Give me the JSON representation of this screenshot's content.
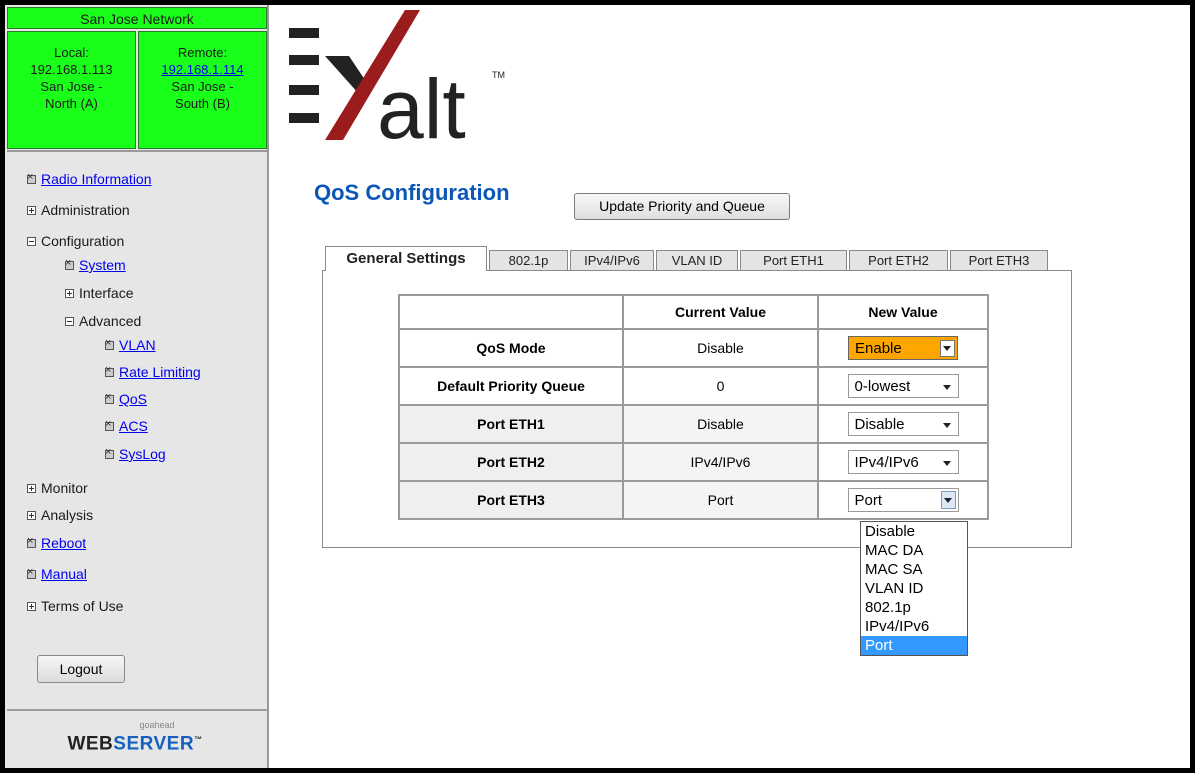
{
  "sidebar": {
    "network_title": "San Jose Network",
    "local": {
      "label": "Local:",
      "ip": "192.168.1.113",
      "site_line1": "San Jose -",
      "site_line2": "North (A)"
    },
    "remote": {
      "label": "Remote:",
      "ip": "192.168.1.114",
      "site_line1": "San Jose -",
      "site_line2": "South (B)"
    },
    "nav": {
      "radio_information": "Radio Information",
      "administration": "Administration",
      "configuration": "Configuration",
      "system": "System",
      "interface": "Interface",
      "advanced": "Advanced",
      "vlan": "VLAN",
      "rate_limiting": "Rate Limiting",
      "qos": "QoS",
      "acs": "ACS",
      "syslog": "SysLog",
      "monitor": "Monitor",
      "analysis": "Analysis",
      "reboot": "Reboot",
      "manual": "Manual",
      "terms_of_use": "Terms of Use"
    },
    "logout_label": "Logout",
    "footer": {
      "small": "goahead",
      "web": "WEB",
      "server": "SERVER",
      "tm": "™"
    }
  },
  "logo": {
    "text": "alt",
    "tm": "TM"
  },
  "main": {
    "title": "QoS Configuration",
    "update_button": "Update Priority and Queue",
    "tabs": [
      "General Settings",
      "802.1p",
      "IPv4/IPv6",
      "VLAN ID",
      "Port ETH1",
      "Port ETH2",
      "Port ETH3"
    ],
    "table": {
      "header": {
        "current": "Current Value",
        "new": "New Value"
      },
      "rows": [
        {
          "label": "QoS Mode",
          "current": "Disable",
          "new": "Enable"
        },
        {
          "label": "Default Priority Queue",
          "current": "0",
          "new": "0-lowest"
        },
        {
          "label": "Port ETH1",
          "current": "Disable",
          "new": "Disable"
        },
        {
          "label": "Port ETH2",
          "current": "IPv4/IPv6",
          "new": "IPv4/IPv6"
        },
        {
          "label": "Port ETH3",
          "current": "Port",
          "new": "Port"
        }
      ]
    },
    "dropdown_options": [
      "Disable",
      "MAC DA",
      "MAC SA",
      "VLAN ID",
      "802.1p",
      "IPv4/IPv6",
      "Port"
    ],
    "dropdown_selected": "Port"
  },
  "colors": {
    "network_green": "#1aff1a",
    "title_blue": "#0b57b8",
    "enable_orange": "#ffa500",
    "highlight": "#3399ff",
    "logo_red": "#9b1c1c"
  }
}
